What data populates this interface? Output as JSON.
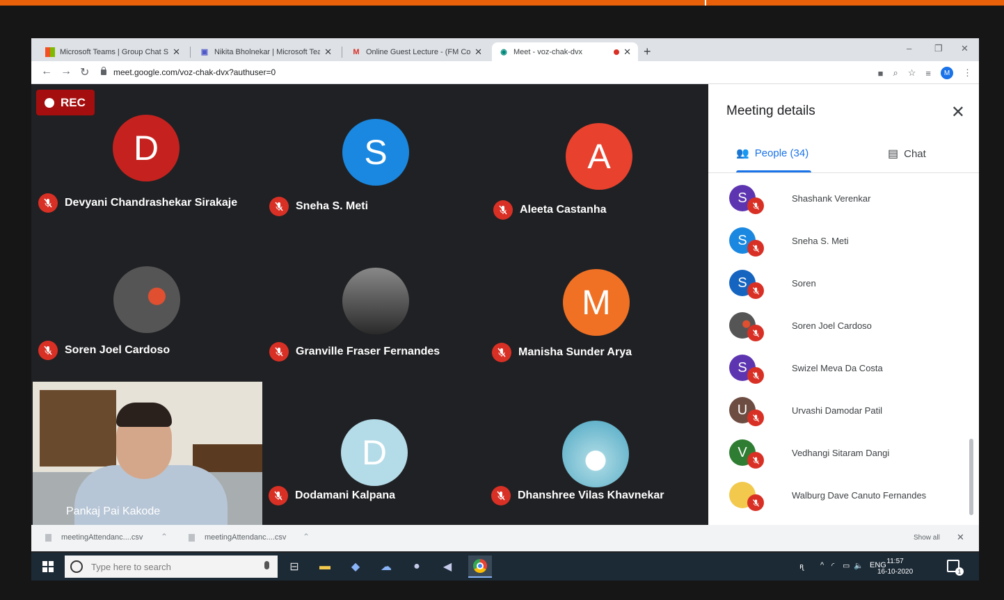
{
  "browser": {
    "tabs": [
      {
        "label": "Microsoft Teams | Group Chat So",
        "icon": "ms-icon",
        "active": false
      },
      {
        "label": "Nikita Bholnekar | Microsoft Tean",
        "icon": "teams-icon",
        "active": false
      },
      {
        "label": "Online Guest Lecture - (FM Coun",
        "icon": "gmail-icon",
        "active": false
      },
      {
        "label": "Meet - voz-chak-dvx",
        "icon": "meet-icon",
        "active": true
      }
    ],
    "new_tab": "+",
    "url": "meet.google.com/voz-chak-dvx?authuser=0",
    "profile_initial": "M",
    "window_controls": [
      "–",
      "❐",
      "✕"
    ]
  },
  "meet": {
    "rec_label": "REC",
    "participants": [
      {
        "name": "Devyani Chandrashekar Sirakaje",
        "initial": "D",
        "color": "#c5221f"
      },
      {
        "name": "Sneha S. Meti",
        "initial": "S",
        "color": "#1a88e0"
      },
      {
        "name": "Aleeta Castanha",
        "initial": "A",
        "color": "#e8412d"
      },
      {
        "name": "Soren Joel Cardoso",
        "initial": "",
        "color": "#555"
      },
      {
        "name": "Granville Fraser Fernandes",
        "initial": "",
        "color": "#444"
      },
      {
        "name": "Manisha Sunder Arya",
        "initial": "M",
        "color": "#f07124"
      },
      {
        "name": "Dodamani Kalpana",
        "initial": "D",
        "color": "#b4dbe8"
      },
      {
        "name": "Dhanshree Vilas Khavnekar",
        "initial": "",
        "color": "#9fd3e0"
      }
    ],
    "self_name": "Pankaj Pai Kakode"
  },
  "details": {
    "title": "Meeting details",
    "people_tab": "People (34)",
    "chat_tab": "Chat",
    "people": [
      {
        "name": "Shashank Verenkar",
        "initial": "S",
        "color": "#5e35b1"
      },
      {
        "name": "Sneha S. Meti",
        "initial": "S",
        "color": "#1a88e0"
      },
      {
        "name": "Soren",
        "initial": "S",
        "color": "#1565c0"
      },
      {
        "name": "Soren Joel Cardoso",
        "initial": "",
        "color": "#555"
      },
      {
        "name": "Swizel Meva Da Costa",
        "initial": "S",
        "color": "#5e35b1"
      },
      {
        "name": "Urvashi Damodar Patil",
        "initial": "U",
        "color": "#6d4c41"
      },
      {
        "name": "Vedhangi Sitaram Dangi",
        "initial": "V",
        "color": "#2e7d32"
      },
      {
        "name": "Walburg Dave Canuto Fernandes",
        "initial": "",
        "color": "#f2c94c"
      }
    ]
  },
  "downloads": {
    "items": [
      "meetingAttendanc....csv",
      "meetingAttendanc....csv"
    ],
    "show_all": "Show all"
  },
  "taskbar": {
    "search_placeholder": "Type here to search",
    "lang": "ENG",
    "time": "11:57",
    "date": "16-10-2020",
    "notification_count": "1"
  }
}
